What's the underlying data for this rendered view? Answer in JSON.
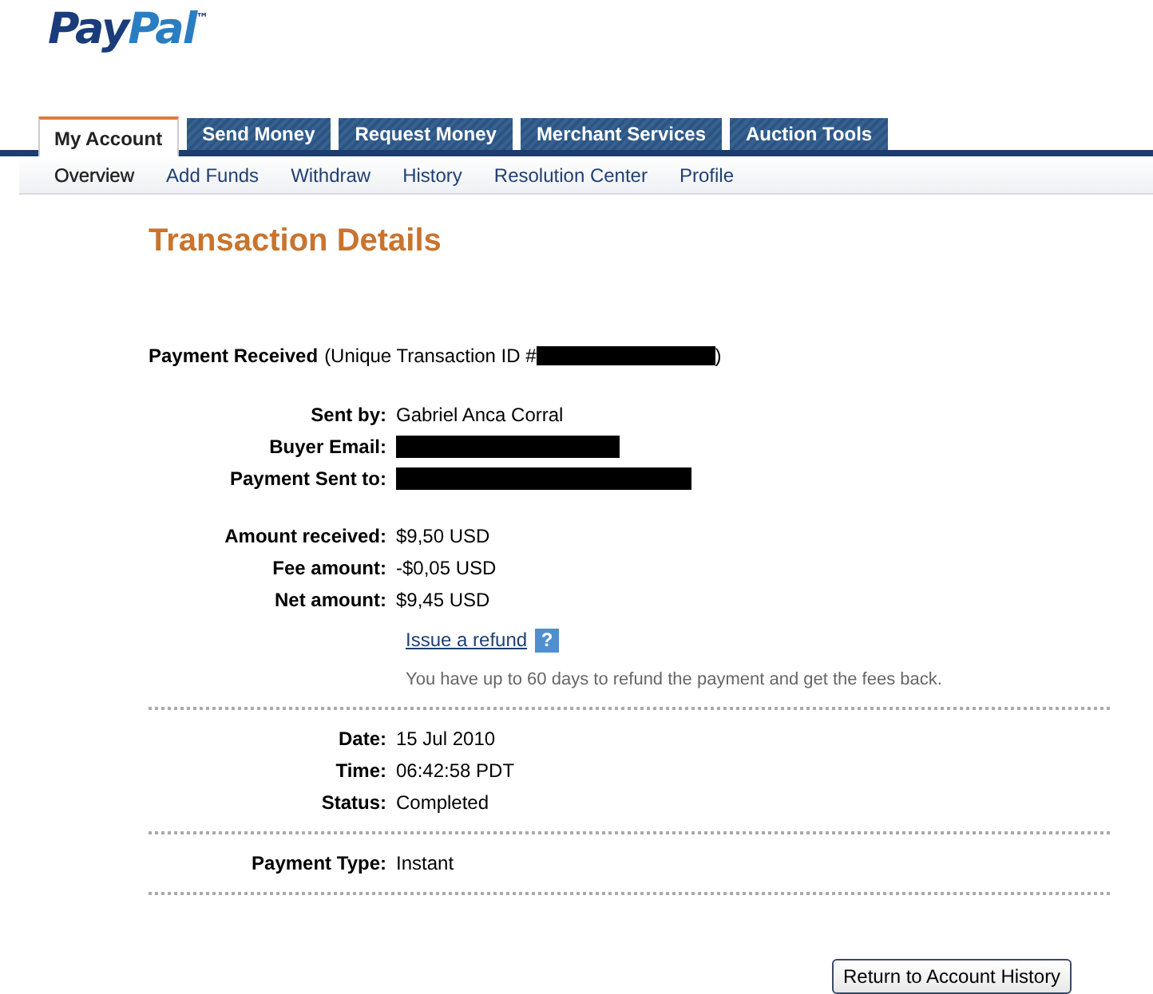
{
  "logo": {
    "text": "PayPal",
    "mark": "™"
  },
  "tabs": [
    {
      "label": "My Account",
      "selected": true
    },
    {
      "label": "Send Money",
      "selected": false
    },
    {
      "label": "Request Money",
      "selected": false
    },
    {
      "label": "Merchant Services",
      "selected": false
    },
    {
      "label": "Auction Tools",
      "selected": false
    }
  ],
  "subnav": [
    {
      "label": "Overview",
      "selected": true
    },
    {
      "label": "Add Funds",
      "selected": false
    },
    {
      "label": "Withdraw",
      "selected": false
    },
    {
      "label": "History",
      "selected": false
    },
    {
      "label": "Resolution Center",
      "selected": false
    },
    {
      "label": "Profile",
      "selected": false
    }
  ],
  "title": "Transaction Details",
  "heading": {
    "bold": "Payment Received",
    "text": "(Unique Transaction ID #",
    "end": ")"
  },
  "sections": [
    {
      "rows": [
        {
          "label": "Sent by:",
          "value": "Gabriel Anca Corral",
          "kind": "text"
        },
        {
          "label": "Buyer Email:",
          "kind": "redacted"
        },
        {
          "label": "Payment Sent to:",
          "kind": "redacted"
        }
      ]
    },
    {
      "rows": [
        {
          "label": "Amount received:",
          "value": "$9,50 USD",
          "kind": "text"
        },
        {
          "label": "Fee amount:",
          "value": "-$0,05 USD",
          "kind": "text"
        },
        {
          "label": "Net amount:",
          "value": "$9,45 USD",
          "kind": "text"
        }
      ],
      "link": {
        "text": "Issue a refund",
        "help": "?"
      },
      "note": "You have up to 60 days to refund the payment and get the fees back."
    },
    {
      "rows": [
        {
          "label": "Date:",
          "value": "15 Jul 2010",
          "kind": "text"
        },
        {
          "label": "Time:",
          "value": "06:42:58 PDT",
          "kind": "text"
        },
        {
          "label": "Status:",
          "value": "Completed",
          "kind": "text"
        }
      ]
    },
    {
      "rows": [
        {
          "label": "Payment Type:",
          "value": "Instant",
          "kind": "text"
        }
      ]
    }
  ],
  "button": "Return to Account History"
}
